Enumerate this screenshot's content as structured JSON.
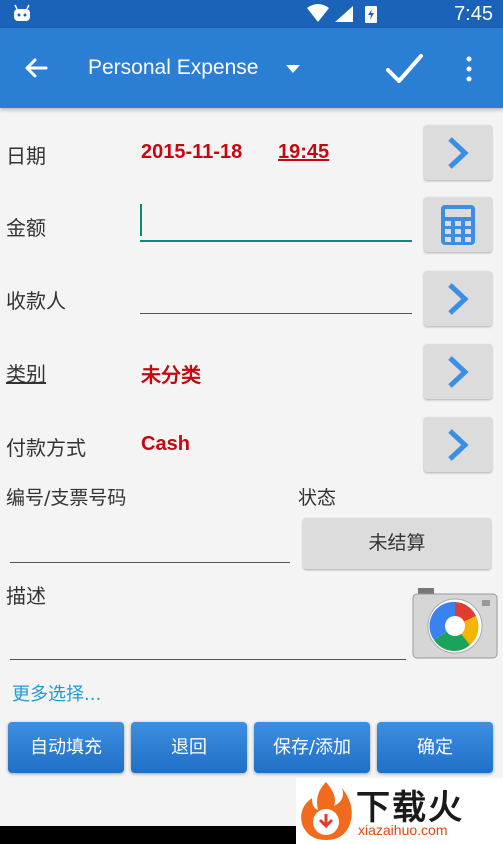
{
  "status_bar": {
    "time": "7:45"
  },
  "app_bar": {
    "title": "Personal Expense"
  },
  "form": {
    "date": {
      "label": "日期",
      "date": "2015-11-18",
      "time": "19:45"
    },
    "amount": {
      "label": "金额",
      "value": ""
    },
    "payee": {
      "label": "收款人",
      "value": ""
    },
    "category": {
      "label": "类别",
      "value": "未分类"
    },
    "payment_method": {
      "label": "付款方式",
      "value": "Cash"
    },
    "check_number": {
      "label": "编号/支票号码",
      "value": ""
    },
    "status": {
      "label": "状态",
      "value": "未结算"
    },
    "description": {
      "label": "描述",
      "value": ""
    },
    "more_options": "更多选择..."
  },
  "buttons": {
    "autofill": "自动填充",
    "back": "退回",
    "save_add": "保存/添加",
    "ok": "确定"
  },
  "watermark": {
    "name": "下载火",
    "url": "xiazaihuo.com"
  },
  "colors": {
    "appbar": "#2a7fd4",
    "statusbar": "#1b63b8",
    "value_red": "#c40812",
    "accent_teal": "#0b8a7f",
    "link_blue": "#1f9bd8"
  }
}
